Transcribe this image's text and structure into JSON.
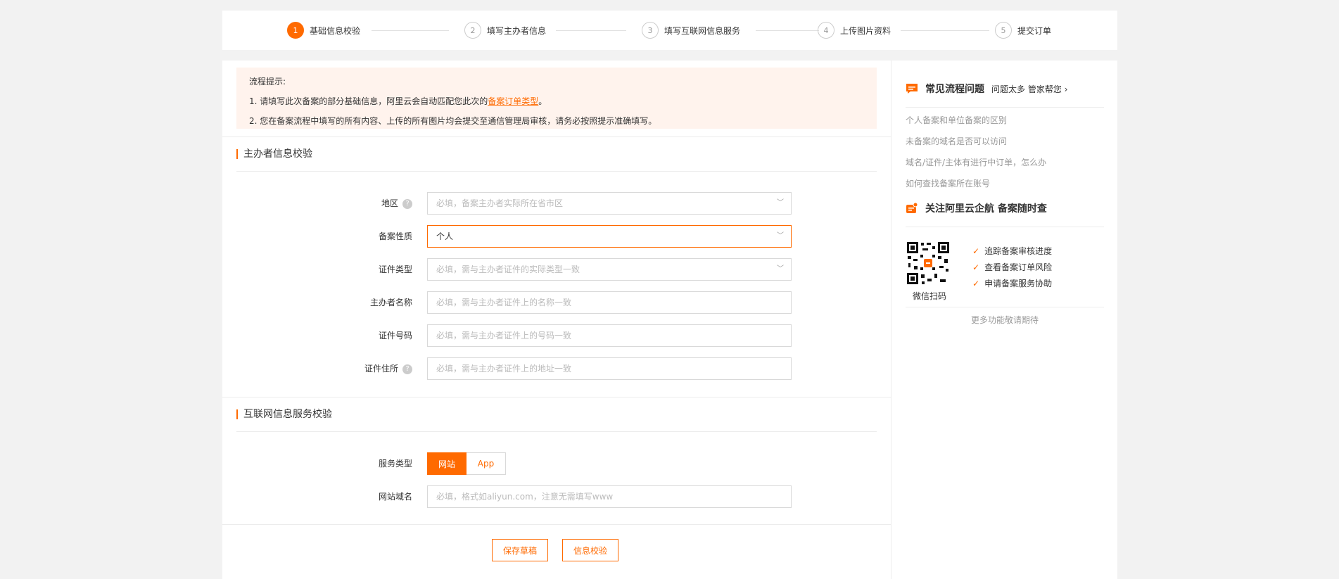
{
  "steps": [
    {
      "num": "1",
      "label": "基础信息校验"
    },
    {
      "num": "2",
      "label": "填写主办者信息"
    },
    {
      "num": "3",
      "label": "填写互联网信息服务"
    },
    {
      "num": "4",
      "label": "上传图片资料"
    },
    {
      "num": "5",
      "label": "提交订单"
    }
  ],
  "tips": {
    "title": "流程提示:",
    "line1_prefix": "1. 请填写此次备案的部分基础信息，阿里云会自动匹配您此次的",
    "line1_link": "备案订单类型",
    "line1_suffix": "。",
    "line2": "2. 您在备案流程中填写的所有内容、上传的所有图片均会提交至通信管理局审核，请务必按照提示准确填写。"
  },
  "section1": {
    "title": "主办者信息校验",
    "fields": {
      "region": {
        "label": "地区",
        "placeholder": "必填，备案主办者实际所在省市区"
      },
      "nature": {
        "label": "备案性质",
        "value": "个人"
      },
      "id_type": {
        "label": "证件类型",
        "placeholder": "必填，需与主办者证件的实际类型一致"
      },
      "owner_name": {
        "label": "主办者名称",
        "placeholder": "必填，需与主办者证件上的名称一致"
      },
      "id_number": {
        "label": "证件号码",
        "placeholder": "必填，需与主办者证件上的号码一致"
      },
      "id_address": {
        "label": "证件住所",
        "placeholder": "必填，需与主办者证件上的地址一致"
      }
    }
  },
  "section2": {
    "title": "互联网信息服务校验",
    "service_type": {
      "label": "服务类型",
      "options": [
        "网站",
        "App"
      ],
      "selected": "网站"
    },
    "domain": {
      "label": "网站域名",
      "placeholder": "必填，格式如aliyun.com，注意无需填写www"
    }
  },
  "actions": {
    "save_draft": "保存草稿",
    "verify": "信息校验"
  },
  "sidebar": {
    "faq_title": "常见流程问题",
    "faq_sub": "问题太多 管家帮您",
    "faq_items": [
      "个人备案和单位备案的区别",
      "未备案的域名是否可以访问",
      "域名/证件/主体有进行中订单，怎么办",
      "如何查找备案所在账号"
    ],
    "follow_title": "关注阿里云企航 备案随时查",
    "qr_caption": "微信扫码",
    "benefits": [
      "追踪备案审核进度",
      "查看备案订单风险",
      "申请备案服务协助"
    ],
    "more": "更多功能敬请期待"
  },
  "colors": {
    "accent": "#ff6a00",
    "tips_bg": "#fff3ed",
    "page_bg": "#f2f2f2"
  },
  "icons": {
    "help": "question-circle-icon",
    "chevron": "chevron-down-icon",
    "check": "check-icon",
    "chat": "chat-bubble-icon",
    "follow": "bell-icon"
  }
}
